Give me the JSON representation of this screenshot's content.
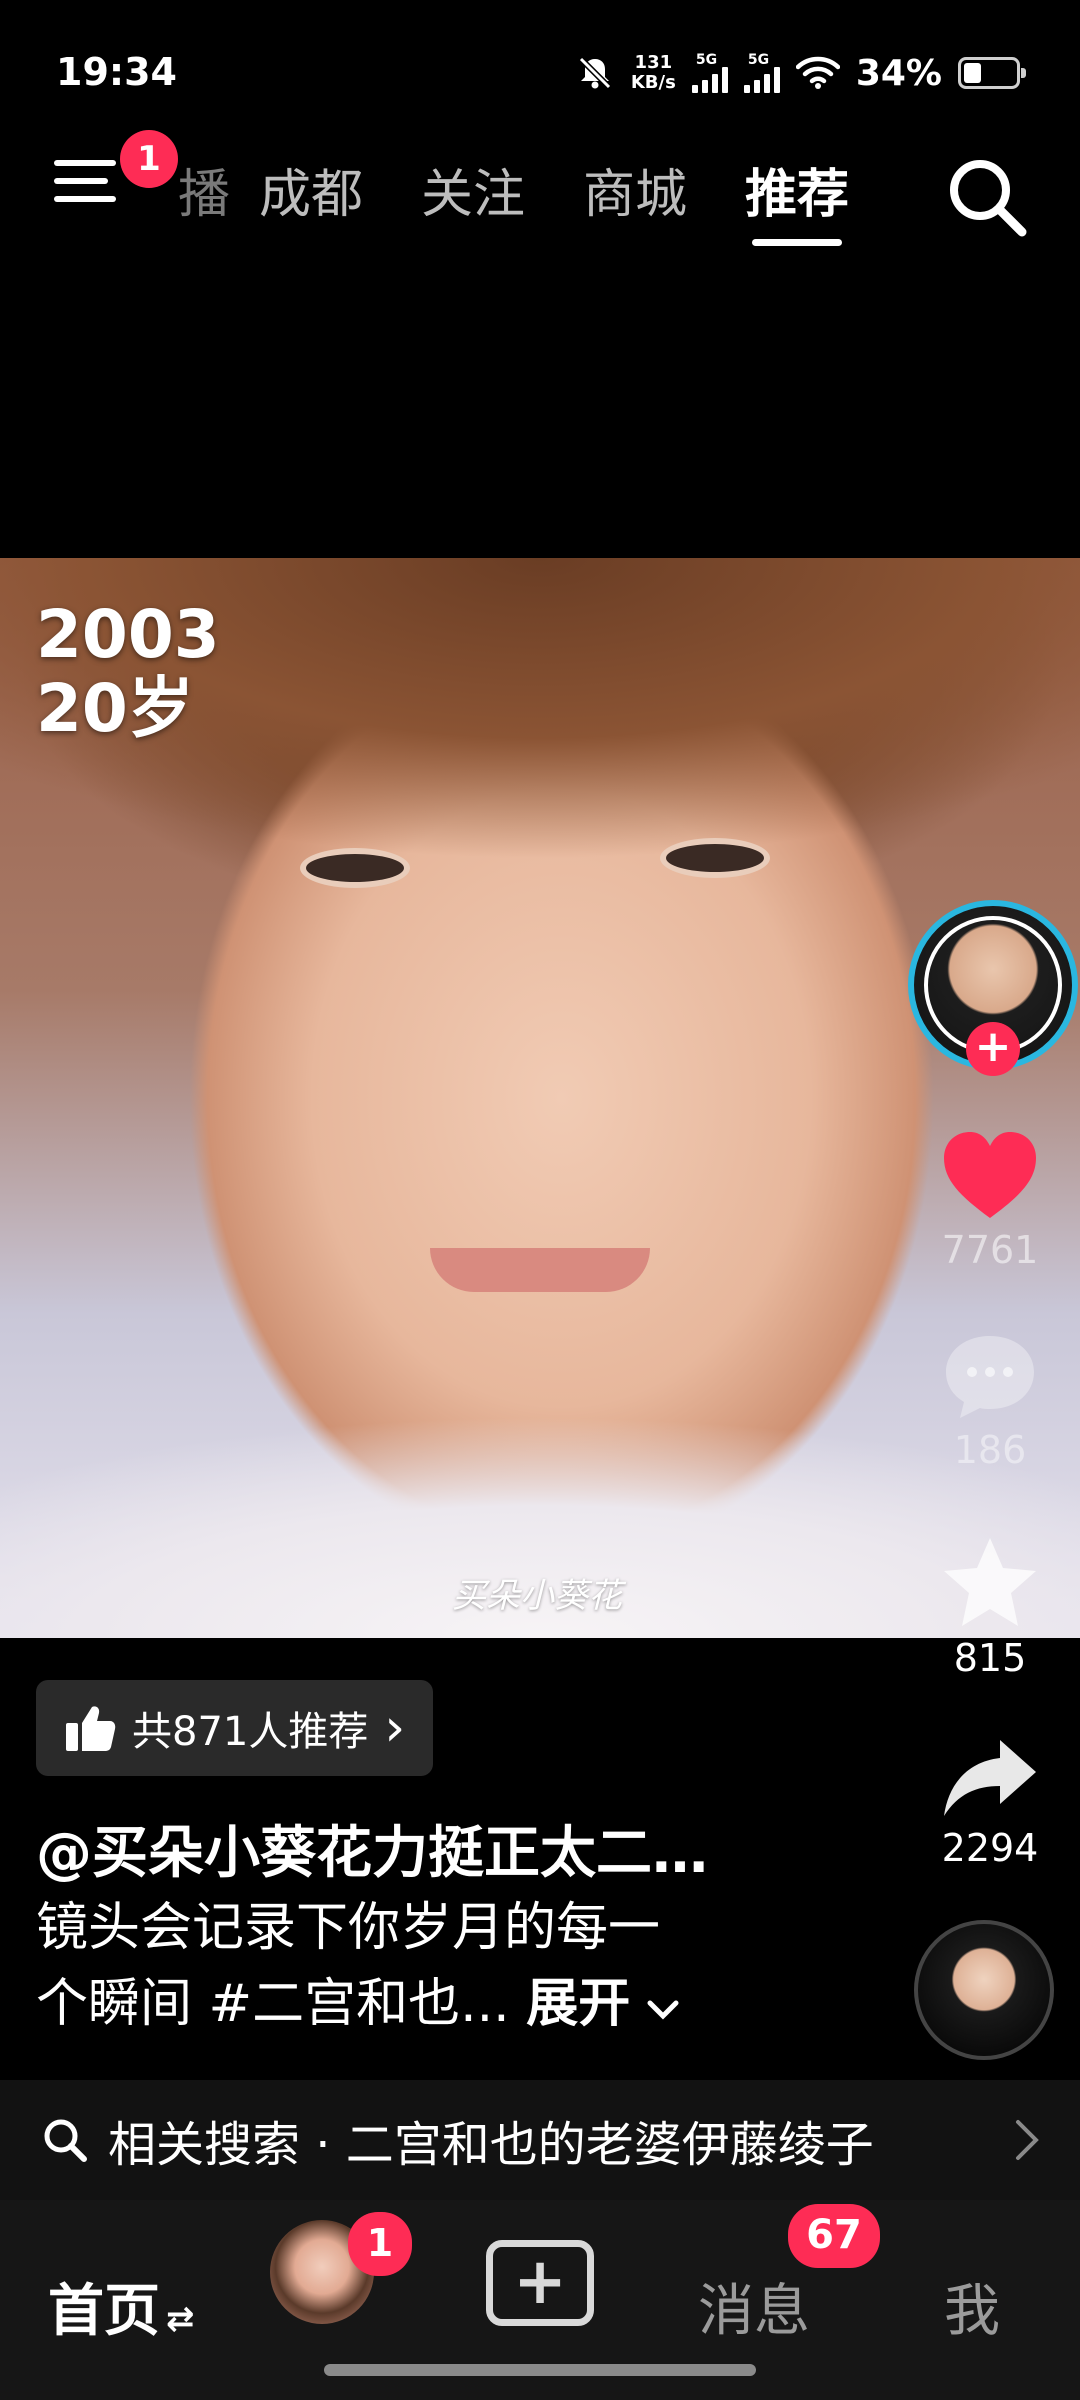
{
  "status_bar": {
    "time": "19:34",
    "speed_value": "131",
    "speed_unit": "KB/s",
    "sim1_label": "5G",
    "sim2_label": "5G",
    "battery_percent": "34%",
    "battery_level": 0.34
  },
  "top_nav": {
    "menu_badge": "1",
    "tabs": [
      {
        "label": "播",
        "partial": true
      },
      {
        "label": "成都"
      },
      {
        "label": "关注"
      },
      {
        "label": "商城"
      },
      {
        "label": "推荐",
        "active": true
      }
    ]
  },
  "video": {
    "overlay_year": "2003",
    "overlay_age": "20岁",
    "watermark": "买朵小葵花"
  },
  "actions": {
    "like_count": "7761",
    "comment_count": "186",
    "favorite_count": "815",
    "share_count": "2294",
    "follow_plus": "+"
  },
  "recommend_pill": {
    "label": "共871人推荐",
    "arrow": "›"
  },
  "post": {
    "author": "@买朵小葵花力挺正太二…",
    "caption_line1": "镜头会记录下你岁月的每一",
    "caption_line2": "个瞬间 #二宫和也... ",
    "expand_label": "展开"
  },
  "related_search": {
    "text": "相关搜索 · 二宫和也的老婆伊藤绫子"
  },
  "bottom_nav": {
    "home_label": "首页",
    "home_swap": "⇄",
    "friend_badge": "1",
    "create_label": "+",
    "messages_label": "消息",
    "messages_badge": "67",
    "me_label": "我"
  },
  "colors": {
    "accent": "#fe2c55",
    "background": "#000000",
    "avatar_ring": "#2ab7e0"
  }
}
